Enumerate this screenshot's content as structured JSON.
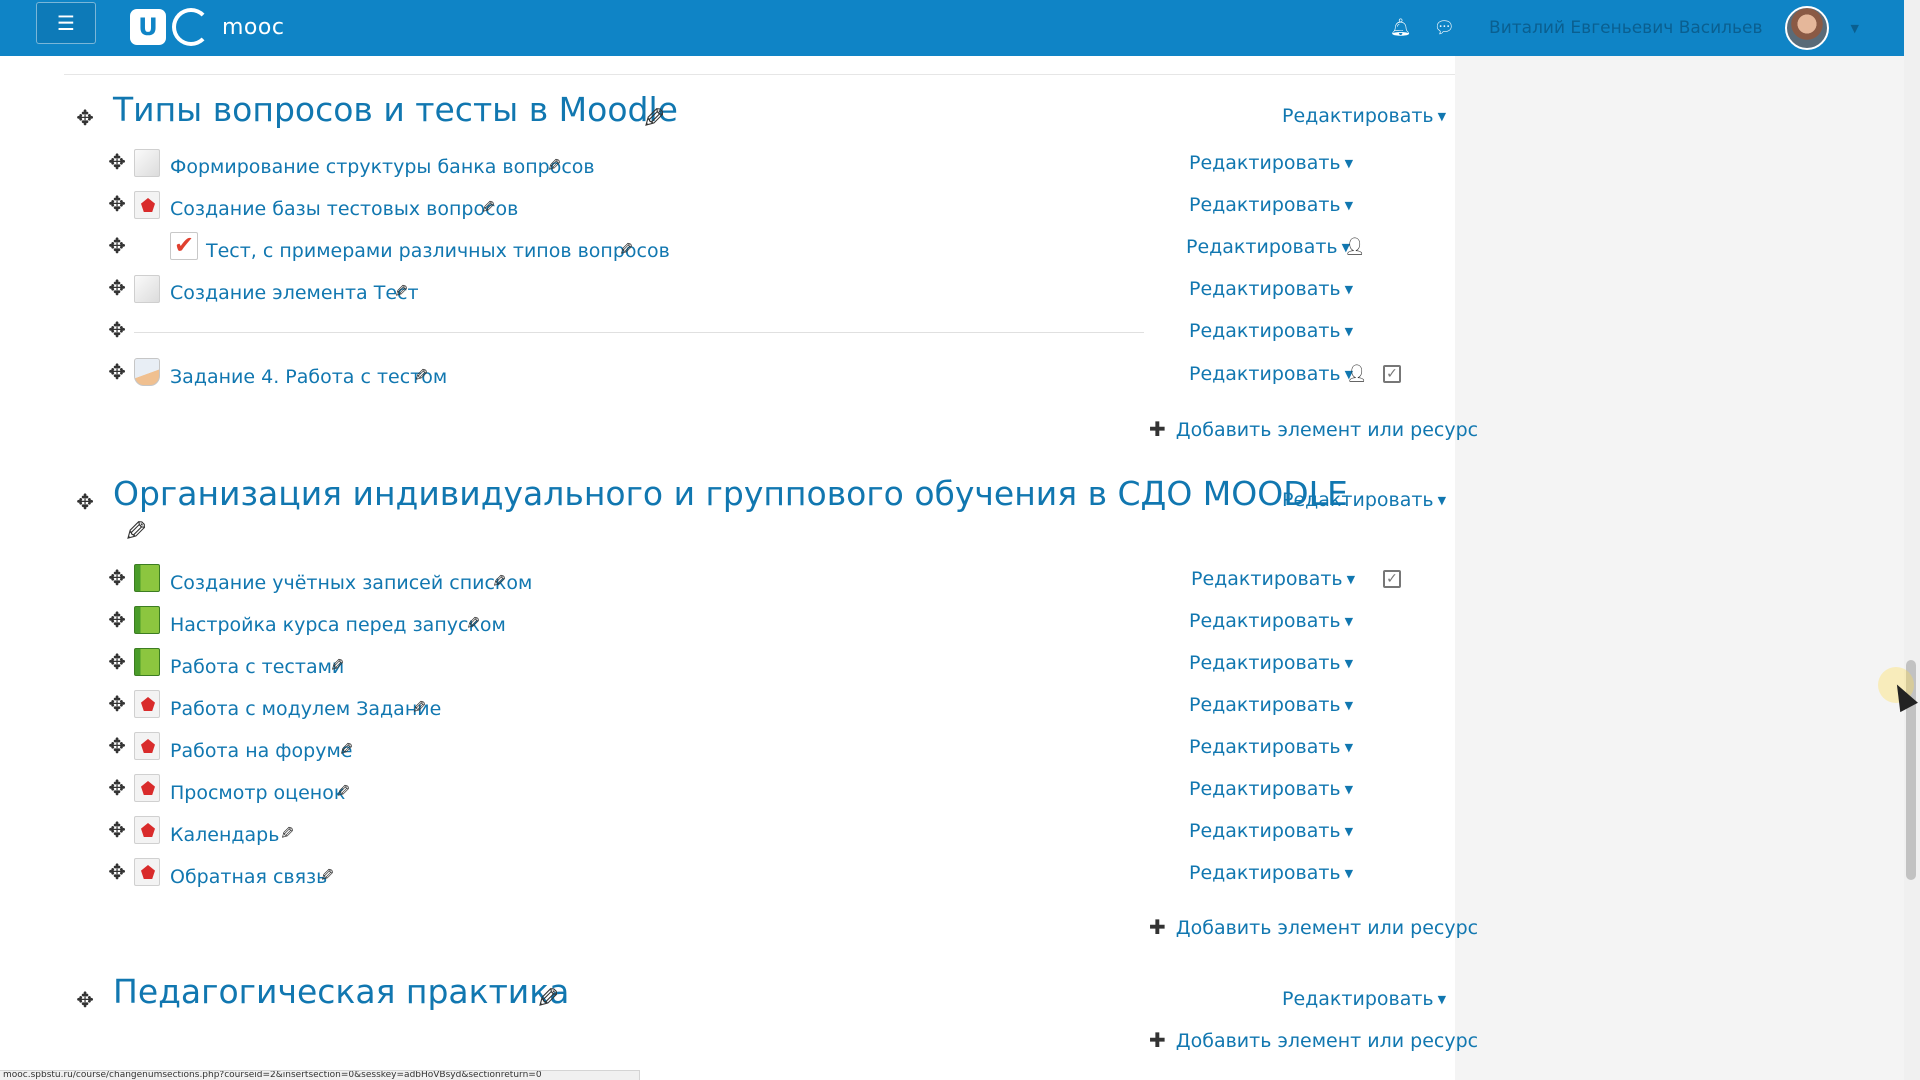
{
  "header": {
    "menu_icon": "hamburger-icon",
    "logo_letter": "U",
    "site_name": "mooc",
    "bell_icon": "bell-icon",
    "chat_icon": "chat-bubble-icon",
    "user_name": "Виталий Евгеньевич Васильев",
    "colors": {
      "navbar": "#0f84c6",
      "link": "#1177b0"
    }
  },
  "sections": [
    {
      "title": "Типы вопросов и тесты в Moodle",
      "edit_label": "Редактировать",
      "add_label": "Добавить элемент или ресурс",
      "activities": [
        {
          "name": "Формирование структуры банка вопросов",
          "icon": "page-icon",
          "edit_label": "Редактировать"
        },
        {
          "name": "Создание базы тестовых вопросов",
          "icon": "pdf-icon",
          "edit_label": "Редактировать"
        },
        {
          "name": "Тест, с примерами различных типов вопросов",
          "icon": "quiz-icon",
          "edit_label": "Редактировать",
          "roles_icon": "person-icon"
        },
        {
          "name": "Создание элемента Тест",
          "icon": "page-icon",
          "edit_label": "Редактировать"
        },
        {
          "name": "",
          "icon": "label-divider",
          "edit_label": "Редактировать"
        },
        {
          "name": "Задание 4. Работа с тестом",
          "icon": "assignment-icon",
          "edit_label": "Редактировать",
          "roles_icon": "person-icon",
          "completion_icon": "checkbox-icon"
        }
      ]
    },
    {
      "title": "Организация индивидуального и группового обучения в СДО MOODLE",
      "edit_label": "Редактировать",
      "add_label": "Добавить элемент или ресурс",
      "activities": [
        {
          "name": "Создание учётных записей списком",
          "icon": "book-icon",
          "edit_label": "Редактировать",
          "completion_icon": "checkbox-icon"
        },
        {
          "name": "Настройка курса перед запуском",
          "icon": "book-icon",
          "edit_label": "Редактировать"
        },
        {
          "name": "Работа с тестами",
          "icon": "book-icon",
          "edit_label": "Редактировать"
        },
        {
          "name": "Работа с модулем Задание",
          "icon": "pdf-icon",
          "edit_label": "Редактировать"
        },
        {
          "name": "Работа на форуме",
          "icon": "pdf-icon",
          "edit_label": "Редактировать"
        },
        {
          "name": "Просмотр оценок",
          "icon": "pdf-icon",
          "edit_label": "Редактировать"
        },
        {
          "name": "Календарь",
          "icon": "pdf-icon",
          "edit_label": "Редактировать"
        },
        {
          "name": "Обратная связь",
          "icon": "pdf-icon",
          "edit_label": "Редактировать"
        }
      ]
    },
    {
      "title": "Педагогическая практика",
      "edit_label": "Редактировать",
      "add_label": "Добавить элемент или ресурс",
      "activities": []
    }
  ],
  "statusbar": {
    "url": "mooc.spbstu.ru/course/changenumsections.php?courseid=2&insertsection=0&sesskey=adbHoVBsyd&sectionreturn=0"
  }
}
